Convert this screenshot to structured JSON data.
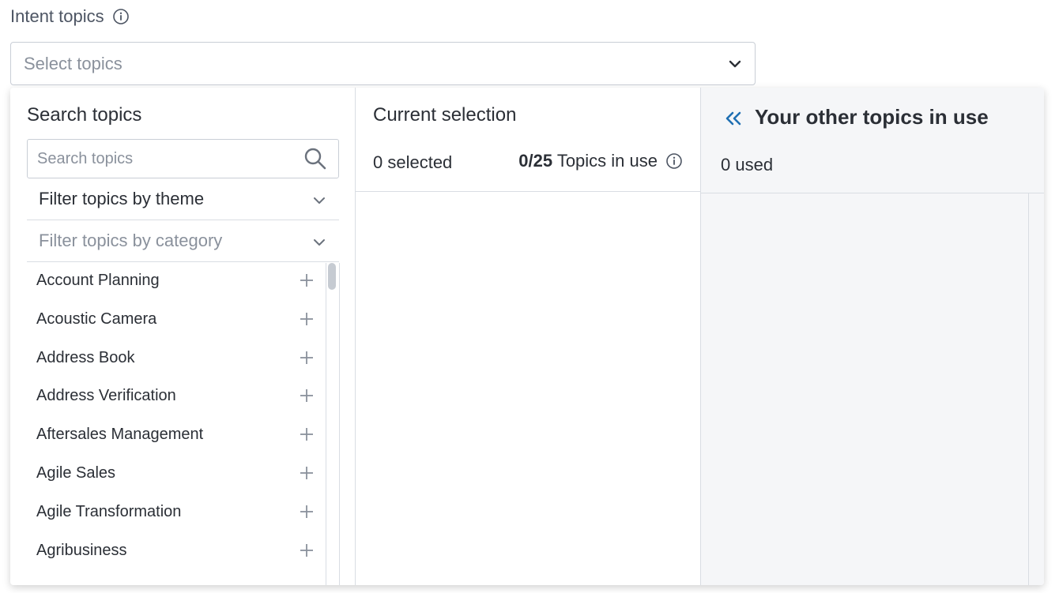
{
  "field": {
    "label": "Intent topics",
    "placeholder": "Select topics"
  },
  "search_panel": {
    "title": "Search topics",
    "search_placeholder": "Search topics",
    "filter_theme": "Filter topics by theme",
    "filter_category": "Filter topics by category",
    "topics": [
      "Account Planning",
      "Acoustic Camera",
      "Address Book",
      "Address Verification",
      "Aftersales Management",
      "Agile Sales",
      "Agile Transformation",
      "Agribusiness"
    ]
  },
  "selection_panel": {
    "title": "Current selection",
    "selected_count": "0 selected",
    "usage_count": "0/25",
    "usage_text": "Topics in use"
  },
  "other_panel": {
    "title": "Your other topics in use",
    "used_count": "0 used"
  },
  "colors": {
    "accent": "#1f6fb2",
    "border": "#c9ced6",
    "text": "#2b2f36",
    "muted": "#8a919c"
  },
  "icons": [
    "info-icon",
    "chevron-down-icon",
    "search-icon",
    "plus-icon",
    "double-chevron-left-icon"
  ]
}
